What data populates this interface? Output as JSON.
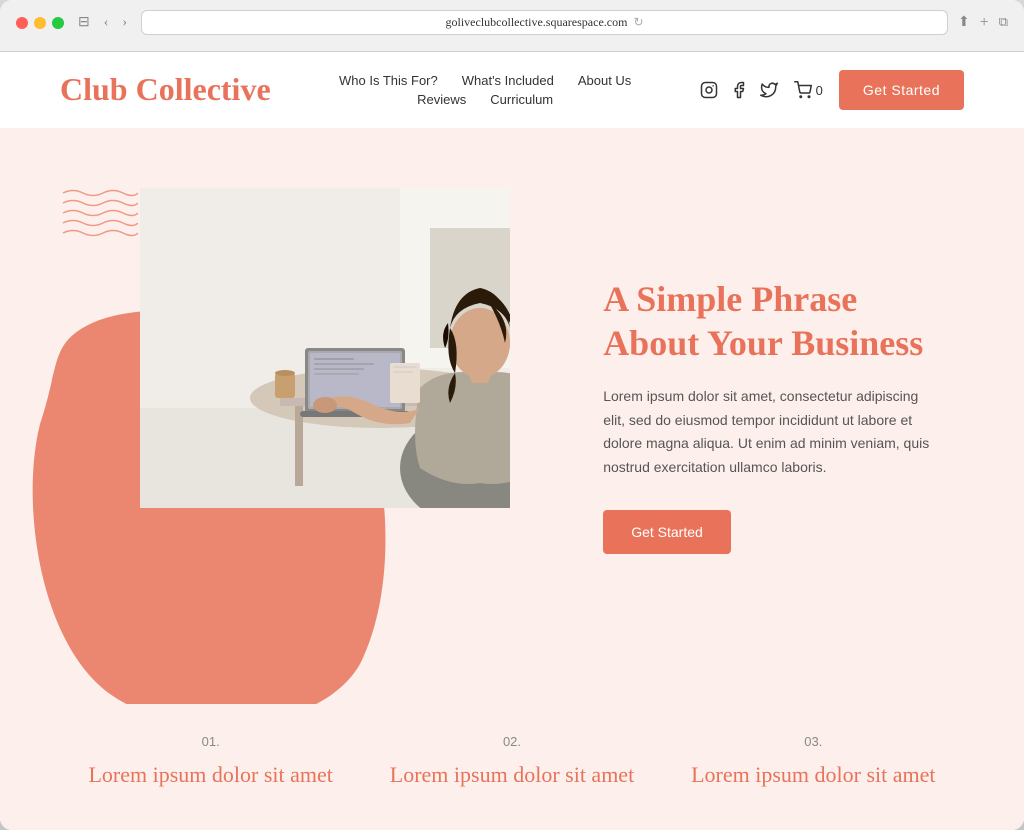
{
  "browser": {
    "url": "goliveclubcollective.squarespace.com",
    "reload_icon": "↻"
  },
  "header": {
    "logo": "Club Collective",
    "nav": {
      "row1": [
        {
          "label": "Who Is This For?",
          "id": "who-is-this-for"
        },
        {
          "label": "What's Included",
          "id": "whats-included"
        },
        {
          "label": "About Us",
          "id": "about-us"
        }
      ],
      "row2": [
        {
          "label": "Reviews",
          "id": "reviews"
        },
        {
          "label": "Curriculum",
          "id": "curriculum"
        }
      ]
    },
    "cart_count": "0",
    "get_started_label": "Get Started"
  },
  "hero": {
    "title": "A Simple Phrase About Your Business",
    "body": "Lorem ipsum dolor sit amet, consectetur adipiscing elit, sed do eiusmod tempor incididunt ut labore et dolore magna aliqua. Ut enim ad minim veniam, quis nostrud exercitation ullamco laboris.",
    "cta_label": "Get Started"
  },
  "features": [
    {
      "number": "01.",
      "title": "Lorem ipsum dolor sit amet"
    },
    {
      "number": "02.",
      "title": "Lorem ipsum dolor sit amet"
    },
    {
      "number": "03.",
      "title": "Lorem ipsum dolor sit amet"
    }
  ],
  "colors": {
    "salmon": "#e8735a",
    "light_bg": "#fdf0ec",
    "blob": "#e8735a"
  }
}
